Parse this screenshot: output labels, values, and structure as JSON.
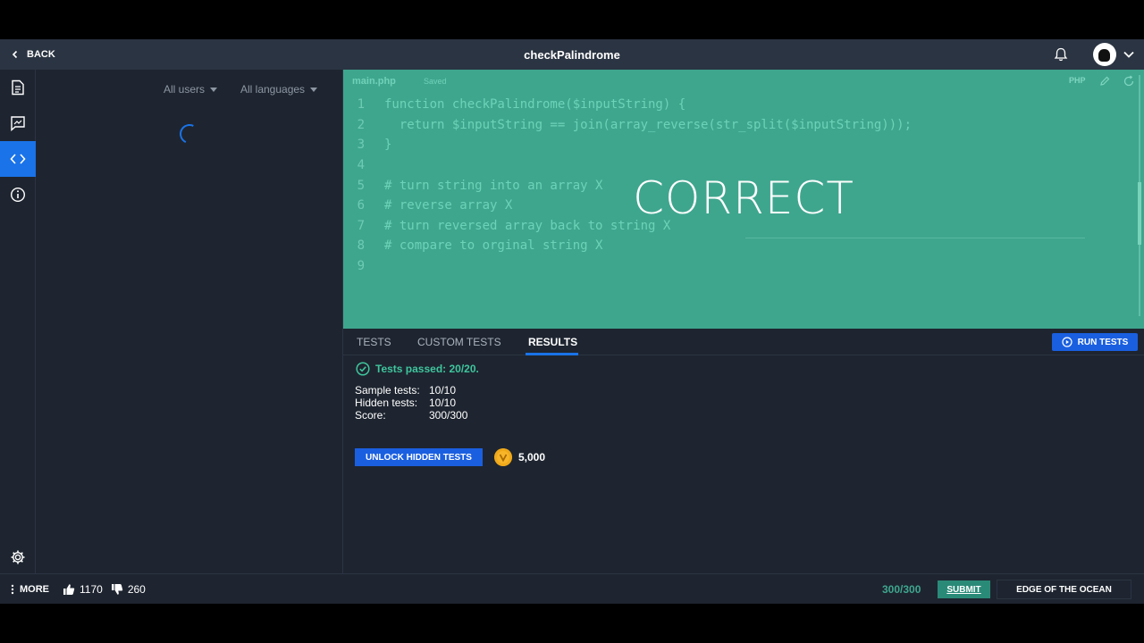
{
  "header": {
    "back_label": "BACK",
    "title": "checkPalindrome"
  },
  "left_panel": {
    "filter_users": "All users",
    "filter_languages": "All languages"
  },
  "editor": {
    "file_tab": "main.php",
    "save_status": "Saved",
    "language": "PHP",
    "overlay": "CORRECT",
    "lines": [
      {
        "num": "1",
        "code": "function checkPalindrome($inputString) {"
      },
      {
        "num": "2",
        "code": "  return $inputString == join(array_reverse(str_split($inputString)));"
      },
      {
        "num": "3",
        "code": "}"
      },
      {
        "num": "4",
        "code": ""
      },
      {
        "num": "5",
        "code": "# turn string into an array X"
      },
      {
        "num": "6",
        "code": "# reverse array X"
      },
      {
        "num": "7",
        "code": "# turn reversed array back to string X"
      },
      {
        "num": "8",
        "code": "# compare to orginal string X"
      },
      {
        "num": "9",
        "code": ""
      }
    ]
  },
  "tabs": [
    {
      "label": "TESTS"
    },
    {
      "label": "CUSTOM TESTS"
    },
    {
      "label": "RESULTS"
    }
  ],
  "results": {
    "run_tests_label": "RUN TESTS",
    "passed_text": "Tests passed: 20/20.",
    "sample_label": "Sample tests:",
    "sample_value": "10/10",
    "hidden_label": "Hidden tests:",
    "hidden_value": "10/10",
    "score_label": "Score:",
    "score_value": "300/300",
    "unlock_label": "UNLOCK HIDDEN TESTS",
    "coin_value": "5,000"
  },
  "footer": {
    "more_label": "MORE",
    "upvotes": "1170",
    "downvotes": "260",
    "score": "300/300",
    "submit_label": "SUBMIT",
    "next_level_label": "EDGE OF THE OCEAN"
  },
  "colors": {
    "accent": "#1a73e8",
    "editor_bg": "#3fa68e",
    "success": "#3fc59d"
  }
}
